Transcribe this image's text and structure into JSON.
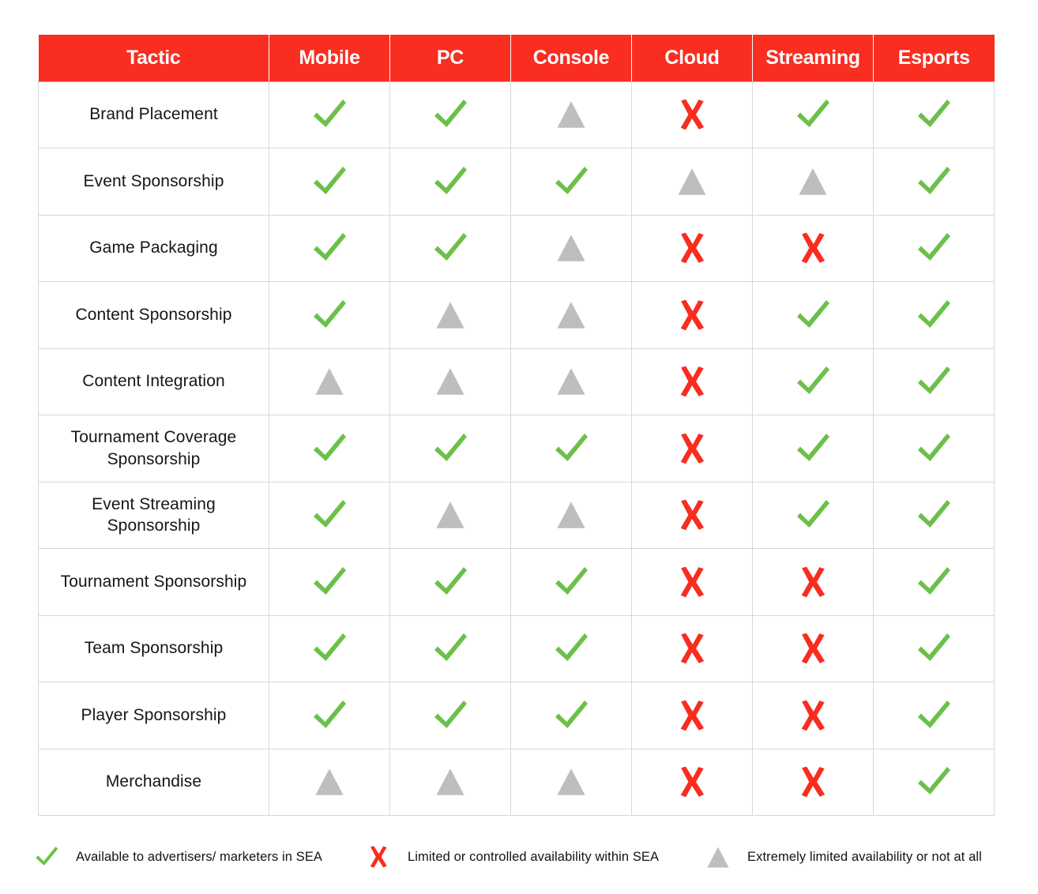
{
  "colors": {
    "header_red": "#F92D20",
    "check_green": "#6CC04A",
    "cross_red": "#F82D20",
    "triangle_gray": "#BEBEBE",
    "grid_line": "#D8D8D8",
    "text_dark": "#161616",
    "background": "#FFFFFF"
  },
  "table": {
    "columns": [
      "Tactic",
      "Mobile",
      "PC",
      "Console",
      "Cloud",
      "Streaming",
      "Esports"
    ],
    "rows": [
      {
        "tactic": "Brand Placement",
        "values": [
          "check",
          "check",
          "triangle",
          "cross",
          "check",
          "check"
        ]
      },
      {
        "tactic": "Event Sponsorship",
        "values": [
          "check",
          "check",
          "check",
          "triangle",
          "triangle",
          "check"
        ]
      },
      {
        "tactic": "Game Packaging",
        "values": [
          "check",
          "check",
          "triangle",
          "cross",
          "cross",
          "check"
        ]
      },
      {
        "tactic": "Content Sponsorship",
        "values": [
          "check",
          "triangle",
          "triangle",
          "cross",
          "check",
          "check"
        ]
      },
      {
        "tactic": "Content Integration",
        "values": [
          "triangle",
          "triangle",
          "triangle",
          "cross",
          "check",
          "check"
        ]
      },
      {
        "tactic": "Tournament Coverage Sponsorship",
        "values": [
          "check",
          "check",
          "check",
          "cross",
          "check",
          "check"
        ]
      },
      {
        "tactic": "Event Streaming Sponsorship",
        "values": [
          "check",
          "triangle",
          "triangle",
          "cross",
          "check",
          "check"
        ]
      },
      {
        "tactic": "Tournament Sponsorship",
        "values": [
          "check",
          "check",
          "check",
          "cross",
          "cross",
          "check"
        ]
      },
      {
        "tactic": "Team Sponsorship",
        "values": [
          "check",
          "check",
          "check",
          "cross",
          "cross",
          "check"
        ]
      },
      {
        "tactic": "Player Sponsorship",
        "values": [
          "check",
          "check",
          "check",
          "cross",
          "cross",
          "check"
        ]
      },
      {
        "tactic": "Merchandise",
        "values": [
          "triangle",
          "triangle",
          "triangle",
          "cross",
          "cross",
          "check"
        ]
      }
    ]
  },
  "legend": [
    {
      "icon": "check-icon",
      "label": "Available to advertisers/ marketers in SEA"
    },
    {
      "icon": "cross-icon",
      "label": "Limited or controlled availability within SEA"
    },
    {
      "icon": "triangle-icon",
      "label": "Extremely limited availability or not at all"
    }
  ]
}
